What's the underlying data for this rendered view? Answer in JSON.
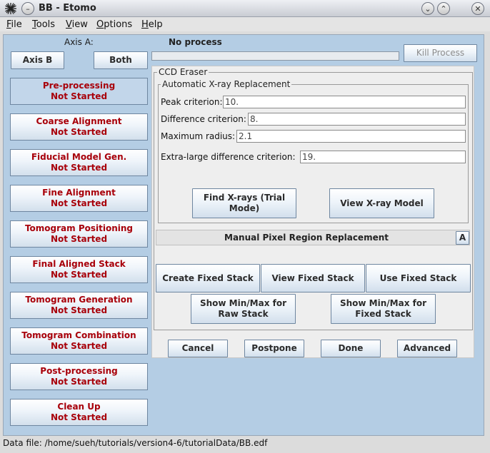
{
  "window": {
    "title": "BB - Etomo"
  },
  "menus": [
    {
      "accel": "F",
      "rest": "ile"
    },
    {
      "accel": "T",
      "rest": "ools"
    },
    {
      "accel": "V",
      "rest": "iew"
    },
    {
      "accel": "O",
      "rest": "ptions"
    },
    {
      "accel": "H",
      "rest": "elp"
    }
  ],
  "axis": {
    "label": "Axis A:",
    "axis_b": "Axis B",
    "both": "Both"
  },
  "process": {
    "status": "No process",
    "kill_label": "Kill Process"
  },
  "stages": [
    {
      "name": "Pre-processing",
      "status": "Not Started"
    },
    {
      "name": "Coarse Alignment",
      "status": "Not Started"
    },
    {
      "name": "Fiducial Model Gen.",
      "status": "Not Started"
    },
    {
      "name": "Fine Alignment",
      "status": "Not Started"
    },
    {
      "name": "Tomogram Positioning",
      "status": "Not Started"
    },
    {
      "name": "Final Aligned Stack",
      "status": "Not Started"
    },
    {
      "name": "Tomogram Generation",
      "status": "Not Started"
    },
    {
      "name": "Tomogram Combination",
      "status": "Not Started"
    },
    {
      "name": "Post-processing",
      "status": "Not Started"
    },
    {
      "name": "Clean Up",
      "status": "Not Started"
    }
  ],
  "eraser": {
    "title": "CCD Eraser",
    "auto_title": "Automatic X-ray Replacement",
    "fields": [
      {
        "label": "Peak criterion:",
        "value": "10."
      },
      {
        "label": "Difference criterion:",
        "value": "8."
      },
      {
        "label": "Maximum radius:",
        "value": "2.1"
      },
      {
        "label": "Extra-large difference criterion:",
        "value": "19."
      }
    ],
    "find_xrays": [
      "Find X-rays (Trial",
      "Mode)"
    ],
    "view_xray_model": "View X-ray Model",
    "manual_title": "Manual Pixel Region Replacement",
    "manual_toggle": "A",
    "create_fixed": "Create Fixed Stack",
    "view_fixed": "View Fixed Stack",
    "use_fixed": "Use Fixed Stack",
    "minmax_raw": [
      "Show Min/Max for",
      "Raw Stack"
    ],
    "minmax_fixed": [
      "Show Min/Max for",
      "Fixed Stack"
    ]
  },
  "dialog_buttons": {
    "cancel": "Cancel",
    "postpone": "Postpone",
    "done": "Done",
    "advanced": "Advanced"
  },
  "status_bar": {
    "text": "Data file: /home/sueh/tutorials/version4-6/tutorialData/BB.edf"
  }
}
